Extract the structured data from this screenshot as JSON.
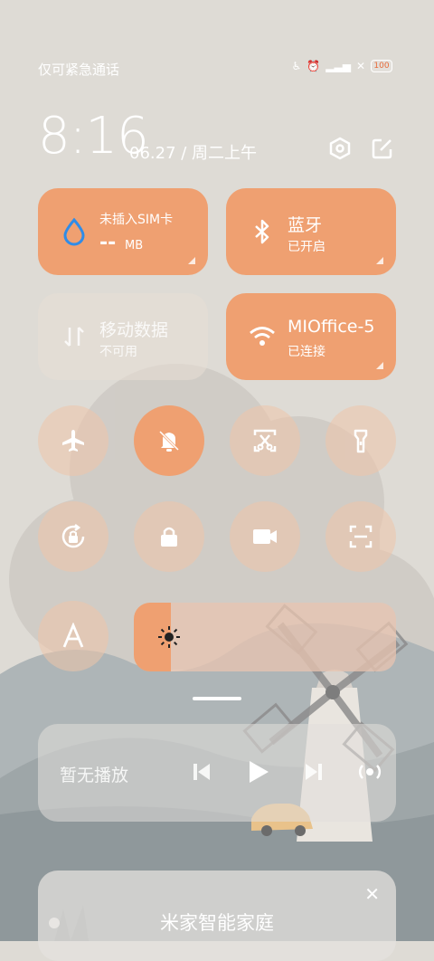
{
  "status_bar": {
    "carrier": "仅可紧急通话",
    "battery": "100"
  },
  "header": {
    "time": "8:16",
    "date": "06.27 / 周二上午",
    "settings_icon": "gear-hex-icon",
    "edit_icon": "edit-icon"
  },
  "tiles": [
    {
      "title": "未插入SIM卡",
      "value": "--",
      "unit": "MB",
      "icon": "water-drop-icon"
    },
    {
      "title": "蓝牙",
      "sub": "已开启",
      "icon": "bluetooth-icon"
    },
    {
      "title": "移动数据",
      "sub": "不可用",
      "icon": "mobile-data-icon"
    },
    {
      "title": "MIOffice-5",
      "sub": "已连接",
      "icon": "wifi-icon"
    }
  ],
  "toggles": [
    {
      "icon": "airplane-icon",
      "on": false
    },
    {
      "icon": "bell-off-icon",
      "on": true
    },
    {
      "icon": "screenshot-icon",
      "on": false
    },
    {
      "icon": "flashlight-icon",
      "on": false
    },
    {
      "icon": "rotation-lock-icon",
      "on": false
    },
    {
      "icon": "lock-icon",
      "on": false
    },
    {
      "icon": "video-record-icon",
      "on": false
    },
    {
      "icon": "scan-icon",
      "on": false
    },
    {
      "icon": "font-size-icon",
      "on": false
    }
  ],
  "brightness": {
    "level_percent": 14
  },
  "media": {
    "title": "暂无播放"
  },
  "home_card": {
    "title": "米家智能家庭",
    "close": "✕"
  },
  "colors": {
    "accent": "#efa071",
    "background": "#dedbd5"
  }
}
